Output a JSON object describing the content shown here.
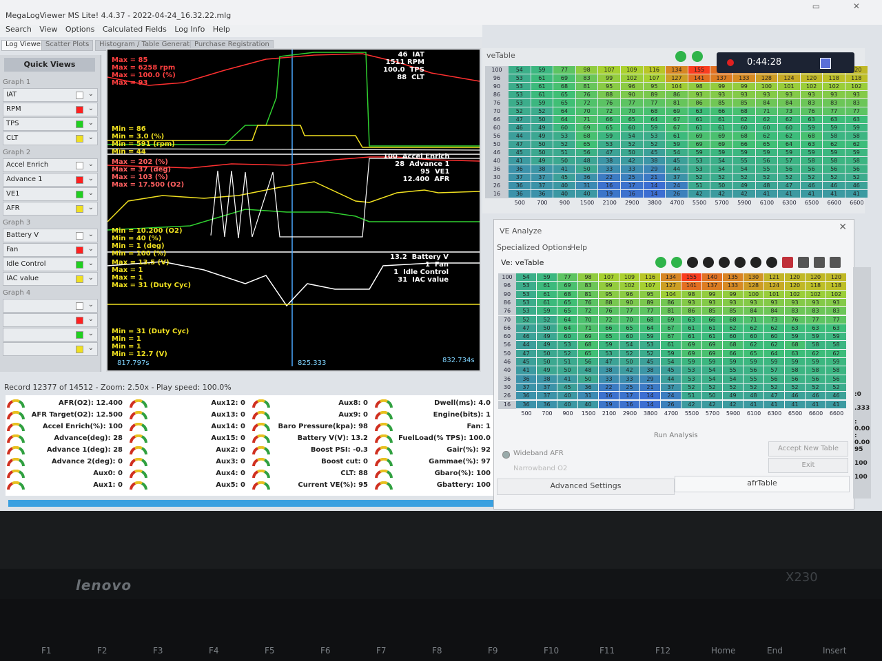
{
  "window": {
    "title": "MegaLogViewer MS Lite! 4.4.37 - 2022-04-24_16.32.22.mlg",
    "controls": "▭ ✕"
  },
  "menu": [
    "Search",
    "View",
    "Options",
    "Calculated Fields",
    "Log Info",
    "Help"
  ],
  "tabs": [
    "Log Viewer",
    "Scatter Plots",
    "Histogram / Table Generator",
    "Purchase Registration"
  ],
  "quick_views": {
    "title": "Quick Views",
    "groups": [
      {
        "label": "Graph 1",
        "items": [
          {
            "name": "IAT",
            "color": "#ffffff"
          },
          {
            "name": "RPM",
            "color": "#ff2020"
          },
          {
            "name": "TPS",
            "color": "#20d020"
          },
          {
            "name": "CLT",
            "color": "#f0e020"
          }
        ]
      },
      {
        "label": "Graph 2",
        "items": [
          {
            "name": "Accel Enrich",
            "color": "#ffffff"
          },
          {
            "name": "Advance 1",
            "color": "#ff2020"
          },
          {
            "name": "VE1",
            "color": "#20d020"
          },
          {
            "name": "AFR",
            "color": "#f0e020"
          }
        ]
      },
      {
        "label": "Graph 3",
        "items": [
          {
            "name": "Battery V",
            "color": "#ffffff"
          },
          {
            "name": "Fan",
            "color": "#ff2020"
          },
          {
            "name": "Idle Control",
            "color": "#20d020"
          },
          {
            "name": "IAC value",
            "color": "#f0e020"
          }
        ]
      },
      {
        "label": "Graph 4",
        "items": [
          {
            "name": "",
            "color": "#ffffff"
          },
          {
            "name": "",
            "color": "#ff2020"
          },
          {
            "name": "",
            "color": "#20d020"
          },
          {
            "name": "",
            "color": "#f0e020"
          }
        ]
      }
    ]
  },
  "graph": {
    "g1_max": "Max = 85\nMax = 6258 rpm\nMax = 100.0 (%)\nMax = 93",
    "g1_min": "Min = 86\nMin = 3.0 (%)\nMin = 591 (rpm)\nMin = 44",
    "g1_right": "46  IAT\n1511 RPM\n100.0  TPS\n88  CLT",
    "g2_max": "Max = 202 (%)\nMax = 37 (deg)\nMax = 103 (%)\nMax = 17.500 (O2)",
    "g2_min": "Min = 10.200 (O2)\nMin = 40 (%)\nMin = 1 (deg)\nMin = 100 (%)",
    "g2_right": "100  Accel Enrich\n28  Advance 1\n95  VE1\n12.400  AFR",
    "g3_max": "Max = 13.5 (V)\nMax = 1\nMax = 1\nMax = 31 (Duty Cyc)",
    "g3_min": "Min = 31 (Duty Cyc)\nMin = 1\nMin = 1\nMin = 12.7 (V)",
    "g3_right": "13.2  Battery V\n1  Fan\n1  Idle Control\n31  IAC value",
    "t_left": "817.797s",
    "t_mid": "825.333",
    "t_right": "832.734s"
  },
  "record_status": "Record 12377 of 14512 - Zoom: 2.50x - Play speed: 100.0%",
  "gauges": [
    [
      "AFR(O2): 12.400",
      "AFR Target(O2): 12.500",
      "Accel Enrich(%): 100",
      "Advance(deg): 28",
      "Advance 1(deg): 28",
      "Advance 2(deg): 0",
      "Aux0: 0",
      "Aux1: 0"
    ],
    [
      "Aux12: 0",
      "Aux13: 0",
      "Aux14: 0",
      "Aux15: 0",
      "Aux2: 0",
      "Aux3: 0",
      "Aux4: 0",
      "Aux5: 0"
    ],
    [
      "Aux8: 0",
      "Aux9: 0",
      "Baro Pressure(kpa): 98",
      "Battery V(V): 13.2",
      "Boost PSI: -0.3",
      "Boost cut: 0",
      "CLT: 88",
      "Current VE(%): 95"
    ],
    [
      "Dwell(ms): 4.0",
      "Engine(bits): 1",
      "Fan: 1",
      "FuelLoad(% TPS): 100.0",
      "Gair(%): 92",
      "Gammae(%): 97",
      "Gbaro(%): 100",
      "Gbattery: 100"
    ]
  ],
  "recorder": {
    "time": "0:44:28"
  },
  "vetable": {
    "title": "veTable",
    "rpm": [
      "500",
      "700",
      "900",
      "1500",
      "2100",
      "2900",
      "3800",
      "4700",
      "5500",
      "5700",
      "5900",
      "6100",
      "6300",
      "6500",
      "6600",
      "6600"
    ],
    "load": [
      "100",
      "96",
      "90",
      "86",
      "76",
      "70",
      "66",
      "60",
      "56",
      "50",
      "46",
      "40",
      "36",
      "30",
      "26",
      "16"
    ],
    "rows": [
      [
        54,
        59,
        77,
        98,
        107,
        109,
        116,
        134,
        155,
        140,
        135,
        130,
        121,
        120,
        120,
        120
      ],
      [
        53,
        61,
        69,
        83,
        99,
        102,
        107,
        127,
        141,
        137,
        133,
        128,
        124,
        120,
        118,
        118
      ],
      [
        53,
        61,
        68,
        81,
        95,
        96,
        95,
        104,
        98,
        99,
        99,
        100,
        101,
        102,
        102,
        102
      ],
      [
        53,
        61,
        65,
        76,
        88,
        90,
        89,
        86,
        93,
        93,
        93,
        93,
        93,
        93,
        93,
        93
      ],
      [
        53,
        59,
        65,
        72,
        76,
        77,
        77,
        81,
        86,
        85,
        85,
        84,
        84,
        83,
        83,
        83
      ],
      [
        52,
        52,
        64,
        70,
        72,
        70,
        68,
        69,
        63,
        66,
        68,
        71,
        73,
        76,
        77,
        77
      ],
      [
        47,
        50,
        64,
        71,
        66,
        65,
        64,
        67,
        61,
        61,
        62,
        62,
        62,
        63,
        63,
        63
      ],
      [
        46,
        49,
        60,
        69,
        65,
        60,
        59,
        67,
        61,
        61,
        60,
        60,
        60,
        59,
        59,
        59
      ],
      [
        44,
        49,
        53,
        68,
        59,
        54,
        53,
        61,
        69,
        69,
        68,
        62,
        62,
        68,
        58,
        58
      ],
      [
        47,
        50,
        52,
        65,
        53,
        52,
        52,
        59,
        69,
        69,
        66,
        65,
        64,
        63,
        62,
        62
      ],
      [
        45,
        50,
        51,
        56,
        47,
        50,
        45,
        54,
        59,
        59,
        59,
        59,
        59,
        59,
        59,
        59
      ],
      [
        41,
        49,
        50,
        48,
        38,
        42,
        38,
        45,
        53,
        54,
        55,
        56,
        57,
        58,
        58,
        58
      ],
      [
        36,
        38,
        41,
        50,
        33,
        33,
        29,
        44,
        53,
        54,
        54,
        55,
        56,
        56,
        56,
        56
      ],
      [
        37,
        37,
        45,
        36,
        22,
        25,
        21,
        37,
        52,
        52,
        52,
        52,
        52,
        52,
        52,
        52
      ],
      [
        36,
        37,
        40,
        31,
        16,
        17,
        14,
        24,
        51,
        50,
        49,
        48,
        47,
        46,
        46,
        46
      ],
      [
        36,
        36,
        40,
        40,
        19,
        16,
        14,
        26,
        42,
        42,
        42,
        41,
        41,
        41,
        41,
        41
      ]
    ]
  },
  "ve_analyze": {
    "title": "VE Analyze",
    "menu": [
      "Specialized Options",
      "Help"
    ],
    "table_label": "Ve: veTable",
    "run_analysis": "Run Analysis",
    "wideband": "Wideband AFR",
    "narrowband": "Narrowband O2",
    "accept": "Accept New Table",
    "exit": "Exit",
    "tab_advanced": "Advanced Settings",
    "tab_afr": "afrTable"
  },
  "right_strip": [
    ":0",
    ".333",
    ": 0.00",
    ": 0.00",
    "95",
    "100",
    "100"
  ],
  "laptop": {
    "brand": "lenovo",
    "model": "X230",
    "fkeys": [
      "F1",
      "F2",
      "F3",
      "F4",
      "F5",
      "F6",
      "F7",
      "F8",
      "F9",
      "F10",
      "F11",
      "F12",
      "Home",
      "End",
      "Insert"
    ]
  }
}
